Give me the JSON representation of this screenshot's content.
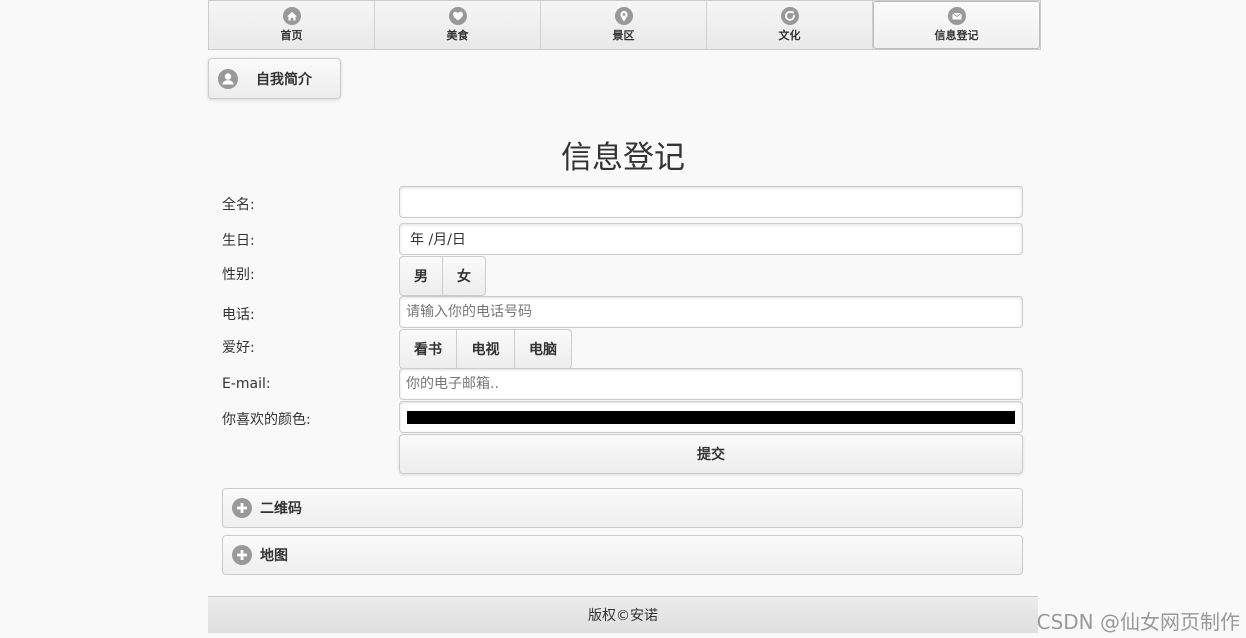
{
  "nav": {
    "items": [
      {
        "label": "首页",
        "icon": "home-icon"
      },
      {
        "label": "美食",
        "icon": "heart-icon"
      },
      {
        "label": "景区",
        "icon": "location-icon"
      },
      {
        "label": "文化",
        "icon": "refresh-icon"
      },
      {
        "label": "信息登记",
        "icon": "mail-icon"
      }
    ],
    "active": "信息登记"
  },
  "intro_button": {
    "label": "自我简介",
    "icon": "user-icon"
  },
  "page_title": "信息登记",
  "form": {
    "fullname": {
      "label": "全名:",
      "value": ""
    },
    "birthday": {
      "label": "生日:",
      "display": "年 /月/日"
    },
    "gender": {
      "label": "性别:",
      "options": [
        "男",
        "女"
      ]
    },
    "phone": {
      "label": "电话:",
      "placeholder": "请输入你的电话号码"
    },
    "hobby": {
      "label": "爱好:",
      "options": [
        "看书",
        "电视",
        "电脑"
      ]
    },
    "email": {
      "label": "E-mail:",
      "placeholder": "你的电子邮箱.."
    },
    "color": {
      "label": "你喜欢的颜色:",
      "value": "#000000"
    },
    "submit_label": "提交"
  },
  "collapsibles": [
    {
      "label": "二维码",
      "icon": "plus-icon"
    },
    {
      "label": "地图",
      "icon": "plus-icon"
    }
  ],
  "footer": {
    "text": "版权©安诺"
  },
  "watermark": "CSDN @仙女网页制作",
  "colors": {
    "icon_gray": "#999999",
    "border": "#cccccc",
    "background": "#f9f9f9"
  }
}
